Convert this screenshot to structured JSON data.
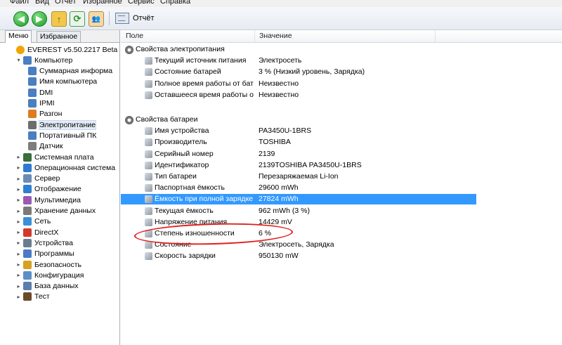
{
  "menubar": [
    "Файл",
    "Вид",
    "Отчёт",
    "Избранное",
    "Сервис",
    "Справка"
  ],
  "toolbar": {
    "report_label": "Отчёт"
  },
  "tabs": [
    "Меню",
    "Избранное"
  ],
  "tree": [
    {
      "label": "EVEREST v5.50.2217 Beta",
      "icon": "info-icon",
      "color": "#f2a400",
      "level": 0,
      "expander": ""
    },
    {
      "label": "Компьютер",
      "icon": "computer-icon",
      "color": "#4a7fc0",
      "level": 1,
      "expander": "▾"
    },
    {
      "label": "Суммарная информа",
      "icon": "summary-icon",
      "color": "#4a7fc0",
      "level": 2,
      "expander": ""
    },
    {
      "label": "Имя компьютера",
      "icon": "computer-name-icon",
      "color": "#4a7fc0",
      "level": 2,
      "expander": ""
    },
    {
      "label": "DMI",
      "icon": "dmi-icon",
      "color": "#4a7fc0",
      "level": 2,
      "expander": ""
    },
    {
      "label": "IPMI",
      "icon": "ipmi-icon",
      "color": "#4a7fc0",
      "level": 2,
      "expander": ""
    },
    {
      "label": "Разгон",
      "icon": "overclock-icon",
      "color": "#e07a1f",
      "level": 2,
      "expander": ""
    },
    {
      "label": "Электропитание",
      "icon": "power-icon",
      "color": "#6d6d6d",
      "level": 2,
      "expander": "",
      "selected": true
    },
    {
      "label": "Портативный ПК",
      "icon": "laptop-icon",
      "color": "#4a7fc0",
      "level": 2,
      "expander": ""
    },
    {
      "label": "Датчик",
      "icon": "sensor-icon",
      "color": "#7d7d7d",
      "level": 2,
      "expander": ""
    },
    {
      "label": "Системная плата",
      "icon": "motherboard-icon",
      "color": "#3a6e3a",
      "level": 1,
      "expander": "▸"
    },
    {
      "label": "Операционная система",
      "icon": "os-icon",
      "color": "#2f7ad0",
      "level": 1,
      "expander": "▸"
    },
    {
      "label": "Сервер",
      "icon": "server-icon",
      "color": "#6a8bb5",
      "level": 1,
      "expander": "▸"
    },
    {
      "label": "Отображение",
      "icon": "display-icon",
      "color": "#2e7fd2",
      "level": 1,
      "expander": "▸"
    },
    {
      "label": "Мультимедиа",
      "icon": "multimedia-icon",
      "color": "#9a5ab3",
      "level": 1,
      "expander": "▸"
    },
    {
      "label": "Хранение данных",
      "icon": "storage-icon",
      "color": "#7a7a7a",
      "level": 1,
      "expander": "▸"
    },
    {
      "label": "Сеть",
      "icon": "network-icon",
      "color": "#3a8fd8",
      "level": 1,
      "expander": "▸"
    },
    {
      "label": "DirectX",
      "icon": "directx-icon",
      "color": "#d03a2a",
      "level": 1,
      "expander": "▸"
    },
    {
      "label": "Устройства",
      "icon": "devices-icon",
      "color": "#6b7c8f",
      "level": 1,
      "expander": "▸"
    },
    {
      "label": "Программы",
      "icon": "programs-icon",
      "color": "#4b7bc4",
      "level": 1,
      "expander": "▸"
    },
    {
      "label": "Безопасность",
      "icon": "security-icon",
      "color": "#d6a21f",
      "level": 1,
      "expander": "▸"
    },
    {
      "label": "Конфигурация",
      "icon": "configuration-icon",
      "color": "#5b8fc7",
      "level": 1,
      "expander": "▸"
    },
    {
      "label": "База данных",
      "icon": "database-icon",
      "color": "#5a7fae",
      "level": 1,
      "expander": "▸"
    },
    {
      "label": "Тест",
      "icon": "test-icon",
      "color": "#6b4a2a",
      "level": 1,
      "expander": "▸"
    }
  ],
  "columns": {
    "field": "Поле",
    "value": "Значение"
  },
  "rows": [
    {
      "type": "group",
      "field": "Свойства электропитания",
      "icon": "power-properties-icon"
    },
    {
      "type": "item",
      "field": "Текущий источник питания",
      "value": "Электросеть"
    },
    {
      "type": "item",
      "field": "Состояние батарей",
      "value": "3 % (Низкий уровень, Зарядка)"
    },
    {
      "type": "item",
      "field": "Полное время работы от бата...",
      "value": "Неизвестно"
    },
    {
      "type": "item",
      "field": "Оставшееся время работы от ...",
      "value": "Неизвестно"
    },
    {
      "type": "spacer"
    },
    {
      "type": "group",
      "field": "Свойства батареи",
      "icon": "battery-properties-icon"
    },
    {
      "type": "item",
      "field": "Имя устройства",
      "value": "PA3450U-1BRS"
    },
    {
      "type": "item",
      "field": "Производитель",
      "value": "TOSHIBA"
    },
    {
      "type": "item",
      "field": "Серийный номер",
      "value": "2139"
    },
    {
      "type": "item",
      "field": "Идентификатор",
      "value": "2139TOSHIBA   PA3450U-1BRS"
    },
    {
      "type": "item",
      "field": "Тип батареи",
      "value": "Перезаряжаемая Li-Ion"
    },
    {
      "type": "item",
      "field": "Паспортная ёмкость",
      "value": "29600 mWh"
    },
    {
      "type": "item",
      "field": "Ёмкость при полной зарядке",
      "value": "27824 mWh",
      "highlighted": true
    },
    {
      "type": "item",
      "field": "Текущая ёмкость",
      "value": "962 mWh  (3 %)"
    },
    {
      "type": "item",
      "field": "Напряжение питания",
      "value": "14429 mV"
    },
    {
      "type": "item",
      "field": "Степень изношенности",
      "value": "6 %",
      "annotated": true
    },
    {
      "type": "item",
      "field": "Состояние",
      "value": "Электросеть, Зарядка"
    },
    {
      "type": "item",
      "field": "Скорость зарядки",
      "value": "950130 mW"
    }
  ],
  "colors": {
    "selection": "#3399ff",
    "annotation": "#e02020",
    "toolbar_green": "#1f9a2b"
  }
}
